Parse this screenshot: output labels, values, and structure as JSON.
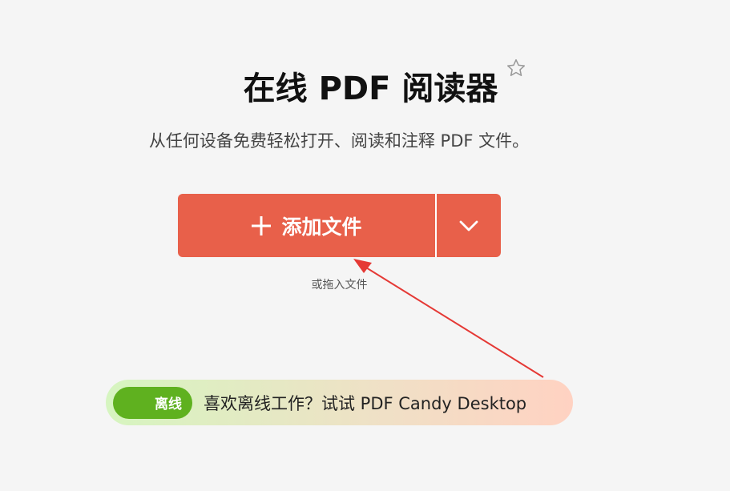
{
  "header": {
    "title": "在线 PDF 阅读器",
    "subtitle": "从任何设备免费轻松打开、阅读和注释 PDF 文件。"
  },
  "upload": {
    "add_label": "添加文件",
    "drop_hint": "或拖入文件",
    "icons": [
      "plus-icon",
      "chevron-down-icon"
    ]
  },
  "banner": {
    "badge": "离线",
    "text": "喜欢离线工作？试试 PDF Candy Desktop"
  },
  "colors": {
    "accent": "#e8604a",
    "badge_green": "#5fb11f",
    "annotation_arrow": "#e53935"
  }
}
